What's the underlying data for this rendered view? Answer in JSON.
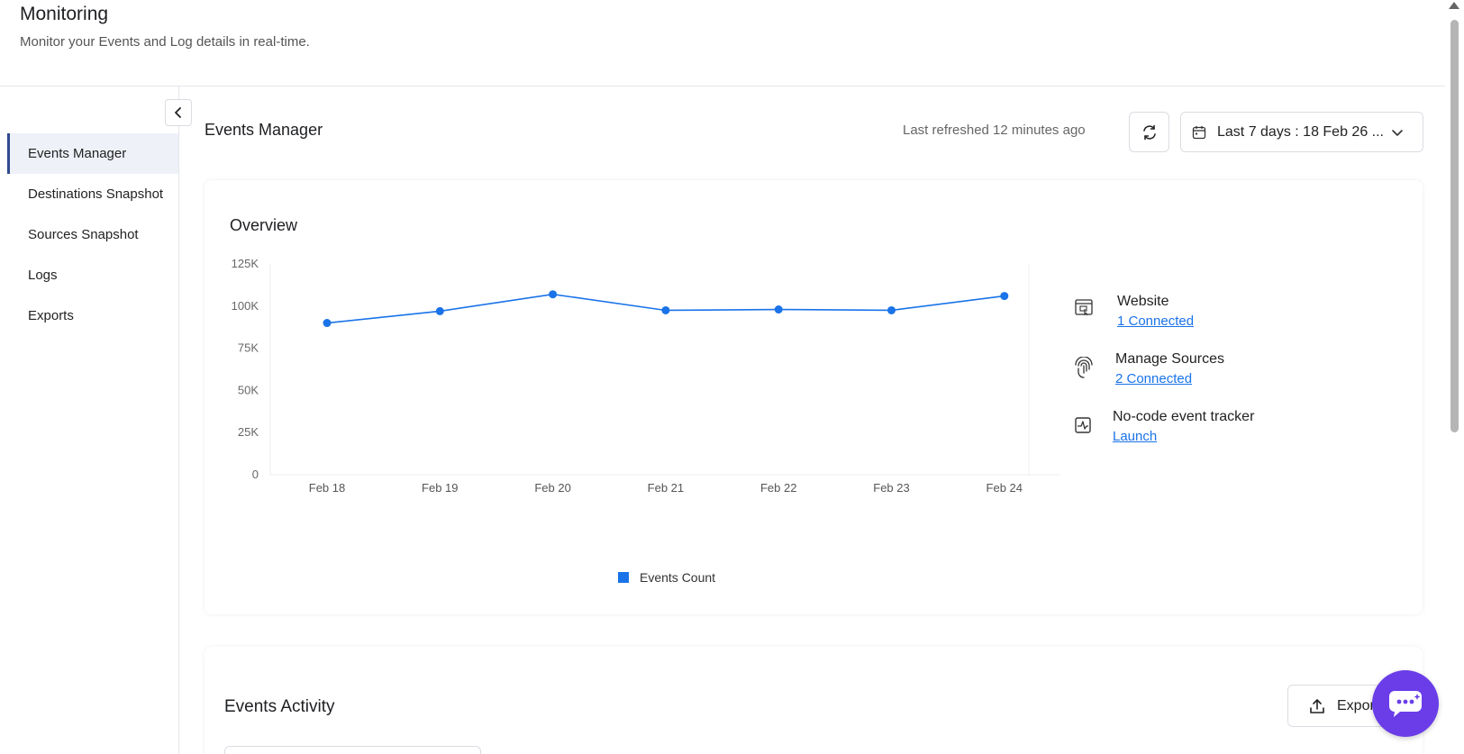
{
  "header": {
    "title": "Monitoring",
    "subtitle": "Monitor your Events and Log details in real-time."
  },
  "sidebar": {
    "items": [
      {
        "label": "Events Manager",
        "active": true
      },
      {
        "label": "Destinations Snapshot",
        "active": false
      },
      {
        "label": "Sources Snapshot",
        "active": false
      },
      {
        "label": "Logs",
        "active": false
      },
      {
        "label": "Exports",
        "active": false
      }
    ]
  },
  "events_manager": {
    "title": "Events Manager",
    "last_refreshed": "Last refreshed 12 minutes ago",
    "date_range": "Last 7 days : 18 Feb 26 ..."
  },
  "overview": {
    "title": "Overview",
    "side_panel": [
      {
        "label": "Website",
        "link": "1 Connected",
        "icon": "website-icon"
      },
      {
        "label": "Manage Sources",
        "link": "2 Connected",
        "icon": "fingerprint-icon"
      },
      {
        "label": "No-code event tracker",
        "link": "Launch",
        "icon": "tracker-icon"
      }
    ],
    "legend": "Events Count"
  },
  "chart_data": {
    "type": "line",
    "categories": [
      "Feb 18",
      "Feb 19",
      "Feb 20",
      "Feb 21",
      "Feb 22",
      "Feb 23",
      "Feb 24"
    ],
    "series": [
      {
        "name": "Events Count",
        "values": [
          90000,
          97000,
          107000,
          97500,
          98000,
          97500,
          106000
        ]
      }
    ],
    "yticks": [
      "0",
      "25K",
      "50K",
      "75K",
      "100K",
      "125K"
    ],
    "ylim": [
      0,
      125000
    ],
    "color": "#1a73e8",
    "legend_position": "bottom"
  },
  "events_activity": {
    "title": "Events Activity",
    "export_label": "Export"
  }
}
